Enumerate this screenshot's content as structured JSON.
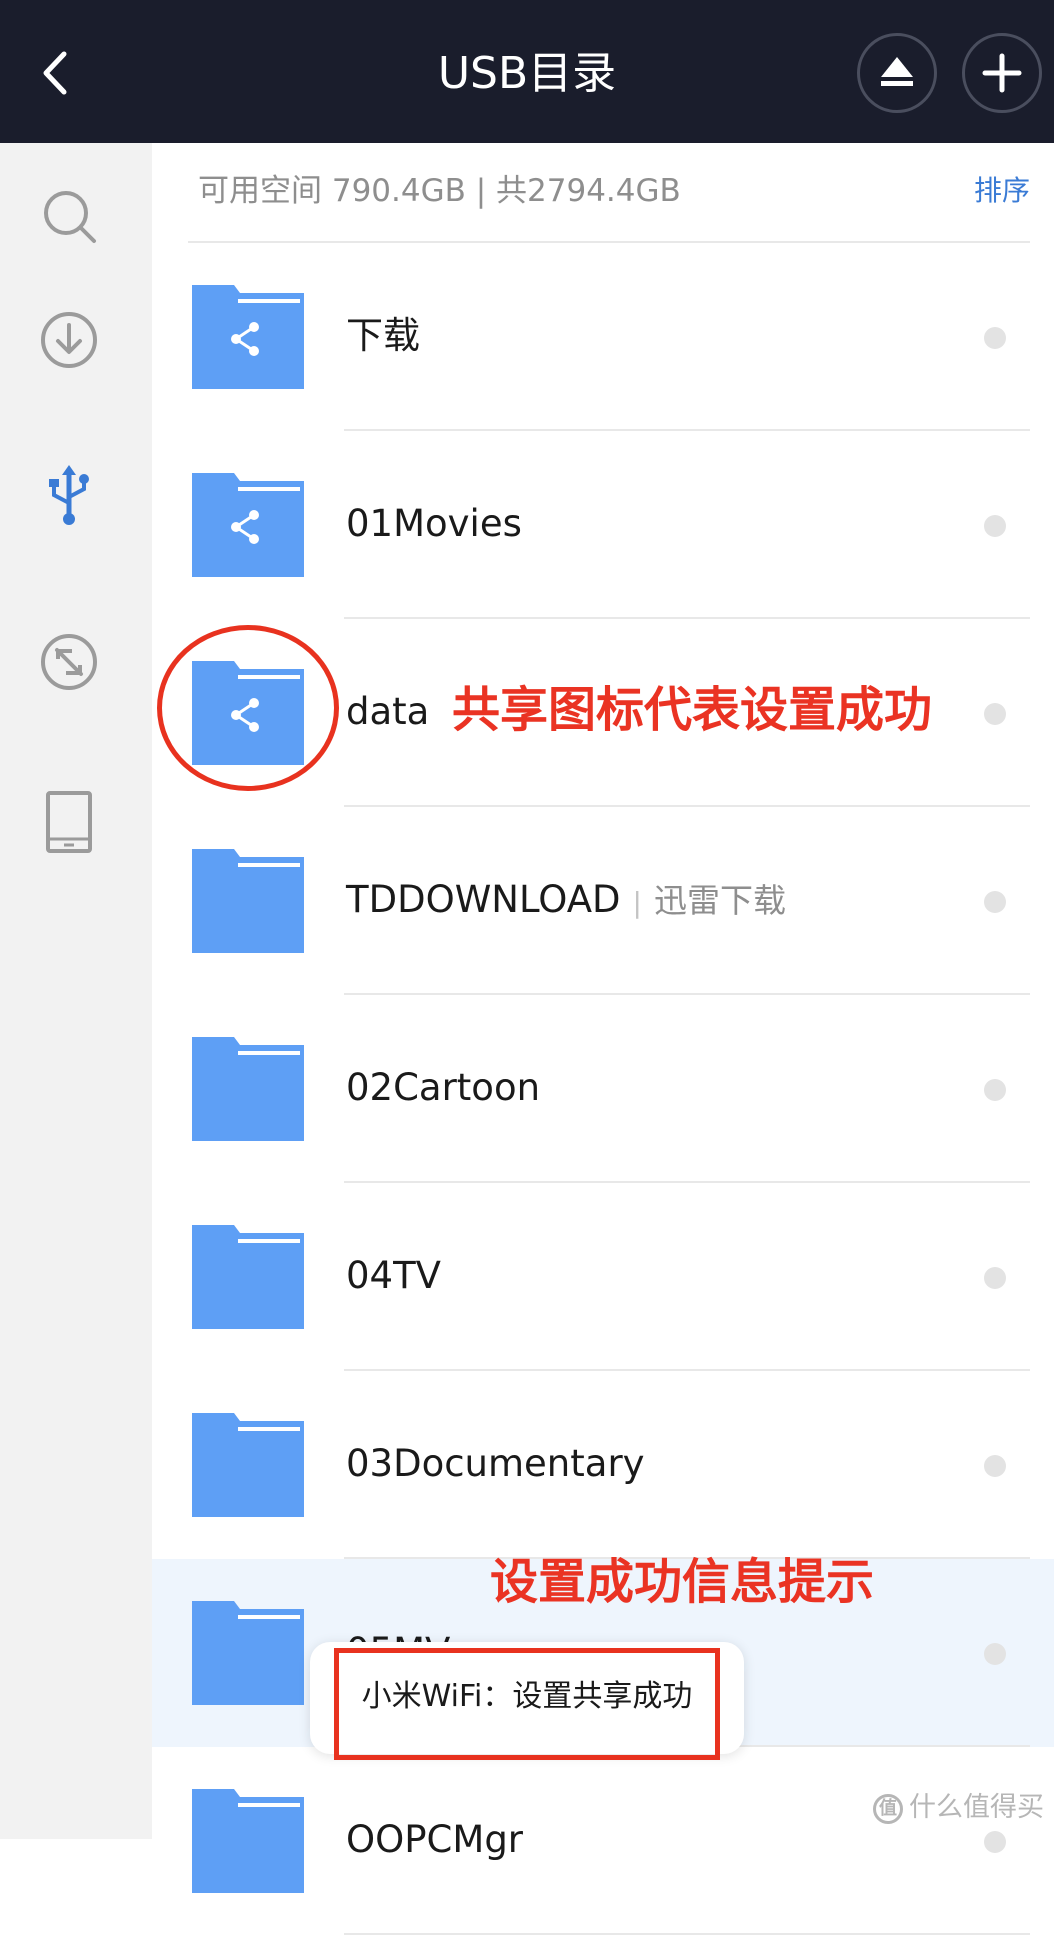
{
  "header": {
    "title": "USB目录",
    "back_icon": "chevron-left-icon",
    "eject_icon": "eject-icon",
    "add_icon": "plus-icon"
  },
  "sidebar": {
    "items": [
      {
        "icon": "search-icon",
        "active": false
      },
      {
        "icon": "download-icon",
        "active": false
      },
      {
        "icon": "usb-icon",
        "active": true
      },
      {
        "icon": "speed-icon",
        "active": false
      },
      {
        "icon": "tablet-icon",
        "active": false
      }
    ]
  },
  "storage": {
    "space_text": "可用空间 790.4GB | 共2794.4GB",
    "sort_label": "排序"
  },
  "folders": [
    {
      "name": "下载",
      "shared": true
    },
    {
      "name": "01Movies",
      "shared": true
    },
    {
      "name": "data",
      "shared": true
    },
    {
      "name": "TDDOWNLOAD",
      "sub": "迅雷下载",
      "sep": "|",
      "shared": false
    },
    {
      "name": "02Cartoon",
      "shared": false
    },
    {
      "name": "04TV",
      "shared": false
    },
    {
      "name": "03Documentary",
      "shared": false
    },
    {
      "name": "05MV",
      "shared": false
    },
    {
      "name": "OOPCMgr",
      "shared": false
    }
  ],
  "annotations": {
    "share_icon_note": "共享图标代表设置成功",
    "success_note": "设置成功信息提示"
  },
  "toast": {
    "message": "小米WiFi：设置共享成功"
  },
  "watermark": {
    "text": "什么值得买",
    "logo_glyph": "值"
  },
  "colors": {
    "topbar": "#1a1d2c",
    "folder_blue": "#5e9ff5",
    "accent_blue": "#3a7bd5",
    "annotation_red": "#ea3323"
  }
}
